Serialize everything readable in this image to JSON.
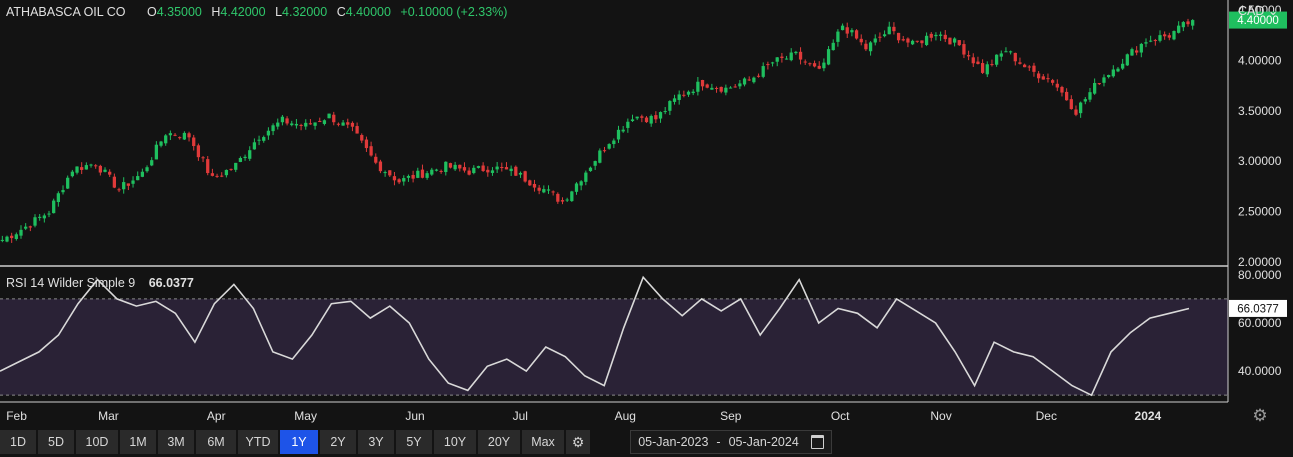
{
  "legend": {
    "symbol": "ATHABASCA OIL CO",
    "o_label": "O",
    "o_value": "4.35000",
    "h_label": "H",
    "h_value": "4.42000",
    "l_label": "L",
    "l_value": "4.32000",
    "c_label": "C",
    "c_value": "4.40000",
    "change": "+0.10000 (+2.33%)"
  },
  "currency": "CAD",
  "rsi_legend": {
    "label": "RSI 14 Wilder Simple 9",
    "value": "66.0377"
  },
  "toolbar": {
    "ranges": [
      "1D",
      "5D",
      "10D",
      "1M",
      "3M",
      "6M",
      "YTD",
      "1Y",
      "2Y",
      "3Y",
      "5Y",
      "10Y",
      "20Y",
      "Max"
    ],
    "active": "1Y"
  },
  "date_range": {
    "start": "05-Jan-2023",
    "separator": "-",
    "end": "05-Jan-2024"
  },
  "colors": {
    "up": "#1fbf5f",
    "down": "#e03a3a",
    "bg": "#131313",
    "rsi_band": "#2a2236",
    "active": "#1e54e8",
    "price_tag": "#1fbf5f"
  },
  "chart_data": {
    "type": "candlestick",
    "price_axis": {
      "min": 2.0,
      "max": 4.5,
      "ticks": [
        "2.00000",
        "2.50000",
        "3.00000",
        "3.50000",
        "4.00000",
        "4.50000"
      ],
      "last_price_label": "4.40000"
    },
    "rsi_axis": {
      "min": 28,
      "max": 82,
      "ticks": [
        "40.0000",
        "60.0000",
        "80.0000"
      ],
      "band": [
        30,
        70
      ],
      "last_value_label": "66.0377"
    },
    "x_axis_labels": [
      "Feb",
      "Mar",
      "Apr",
      "May",
      "Jun",
      "Jul",
      "Aug",
      "Sep",
      "Oct",
      "Nov",
      "Dec",
      "2024"
    ],
    "month_positions": [
      0.72,
      4.72,
      9.41,
      13.3,
      18.06,
      22.64,
      27.21,
      31.8,
      36.56,
      40.95,
      45.53,
      49.95
    ],
    "n_weeks": 52,
    "weekly_close": [
      2.22,
      2.35,
      2.5,
      2.92,
      2.98,
      2.72,
      2.88,
      3.28,
      3.25,
      2.82,
      2.96,
      3.25,
      3.4,
      3.35,
      3.45,
      3.3,
      2.98,
      2.8,
      2.88,
      2.95,
      2.9,
      2.94,
      2.88,
      2.75,
      2.6,
      2.9,
      3.2,
      3.45,
      3.42,
      3.65,
      3.78,
      3.72,
      3.8,
      3.98,
      4.05,
      3.88,
      4.35,
      4.12,
      4.3,
      4.15,
      4.28,
      4.15,
      3.9,
      4.1,
      3.9,
      3.8,
      3.5,
      3.8,
      4.0,
      4.2,
      4.25,
      4.4
    ],
    "rsi": [
      40,
      44,
      48,
      55,
      68,
      78,
      70,
      67,
      69,
      64,
      52,
      68,
      76,
      66,
      48,
      45,
      55,
      68,
      69,
      62,
      67,
      60,
      45,
      35,
      32,
      42,
      45,
      40,
      50,
      46,
      38,
      34,
      58,
      79,
      70,
      63,
      70,
      65,
      70,
      55,
      66,
      78,
      60,
      66,
      64,
      58,
      70,
      65,
      60,
      48,
      34,
      52,
      48,
      46,
      40,
      34,
      30,
      48,
      56,
      62,
      64,
      66
    ]
  }
}
